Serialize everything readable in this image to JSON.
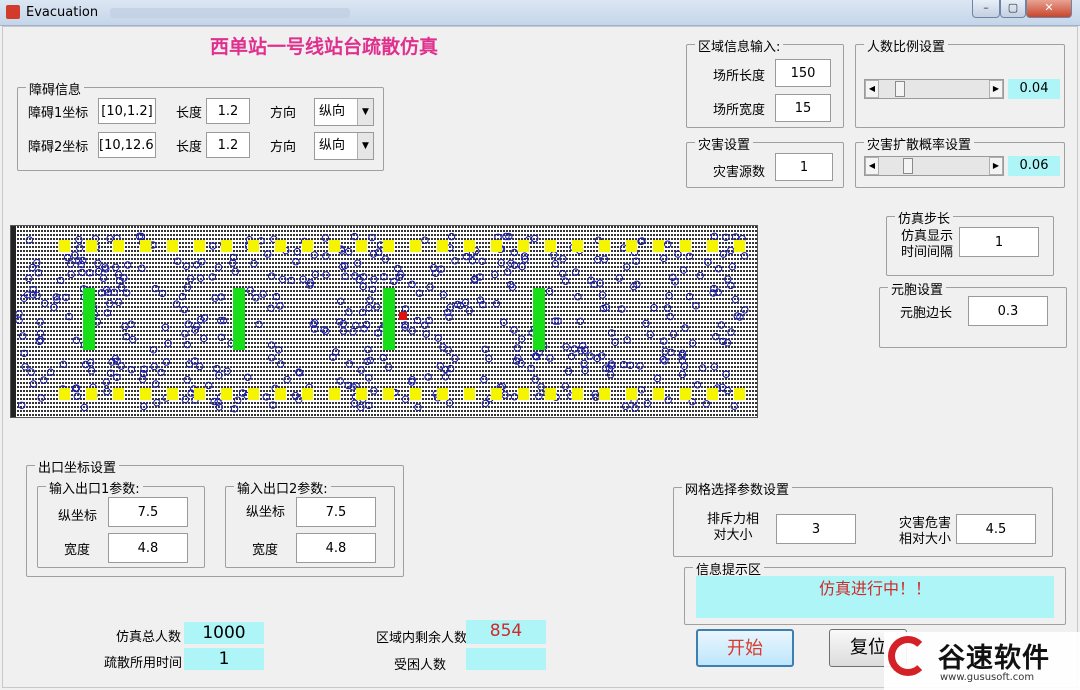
{
  "window": {
    "title": "Evacuation",
    "minimize": "–",
    "maximize": "▢",
    "close": "✕"
  },
  "page_title": "西单站一号线站台疏散仿真",
  "obstacle": {
    "group_title": "障碍信息",
    "rows": [
      {
        "coord_label": "障碍1坐标",
        "coord": "[10,1.2]",
        "length_label": "长度",
        "length": "1.2",
        "dir_label": "方向",
        "dir": "纵向"
      },
      {
        "coord_label": "障碍2坐标",
        "coord": "[10,12.6]",
        "length_label": "长度",
        "length": "1.2",
        "dir_label": "方向",
        "dir": "纵向"
      }
    ]
  },
  "area": {
    "group_title": "区域信息输入:",
    "length_label": "场所长度",
    "length": "150",
    "width_label": "场所宽度",
    "width": "15"
  },
  "ratio": {
    "group_title": "人数比例设置",
    "value": "0.04",
    "fraction": 0.04
  },
  "disaster": {
    "group_title": "灾害设置",
    "source_label": "灾害源数",
    "source": "1"
  },
  "spread": {
    "group_title": "灾害扩散概率设置",
    "value": "0.06",
    "fraction": 0.06
  },
  "step": {
    "group_title": "仿真步长",
    "label_line1": "仿真显示",
    "label_line2": "时间间隔",
    "value": "1"
  },
  "cell": {
    "group_title": "元胞设置",
    "label": "元胞边长",
    "value": "0.3"
  },
  "exit": {
    "group_title": "出口坐标设置",
    "exit1": {
      "title": "输入出口1参数:",
      "y_label": "纵坐标",
      "y": "7.5",
      "w_label": "宽度",
      "w": "4.8"
    },
    "exit2": {
      "title": "输入出口2参数:",
      "y_label": "纵坐标",
      "y": "7.5",
      "w_label": "宽度",
      "w": "4.8"
    }
  },
  "grid": {
    "group_title": "网格选择参数设置",
    "repulse_line1": "排斥力相",
    "repulse_line2": "对大小",
    "repulse": "3",
    "hazard_line1": "灾害危害",
    "hazard_line2": "相对大小",
    "hazard": "4.5"
  },
  "info": {
    "group_title": "信息提示区",
    "message": "仿真进行中！！"
  },
  "stats": {
    "total_label": "仿真总人数",
    "total": "1000",
    "time_label": "疏散所用时间",
    "time": "1",
    "remaining_label": "区域内剩余人数",
    "remaining": "854",
    "trapped_label": "受困人数",
    "trapped": ""
  },
  "buttons": {
    "start": "开始",
    "reset": "复位"
  },
  "logo": {
    "text": "谷速软件",
    "url": "www.gususoft.com"
  },
  "colors": {
    "title": "#e0308e",
    "readout": "#aef5f7",
    "alert": "#d02a2a",
    "obstacle": "#18e018",
    "exit": "#f5f500",
    "person": "#1a1aa8",
    "fire": "#e01010"
  }
}
